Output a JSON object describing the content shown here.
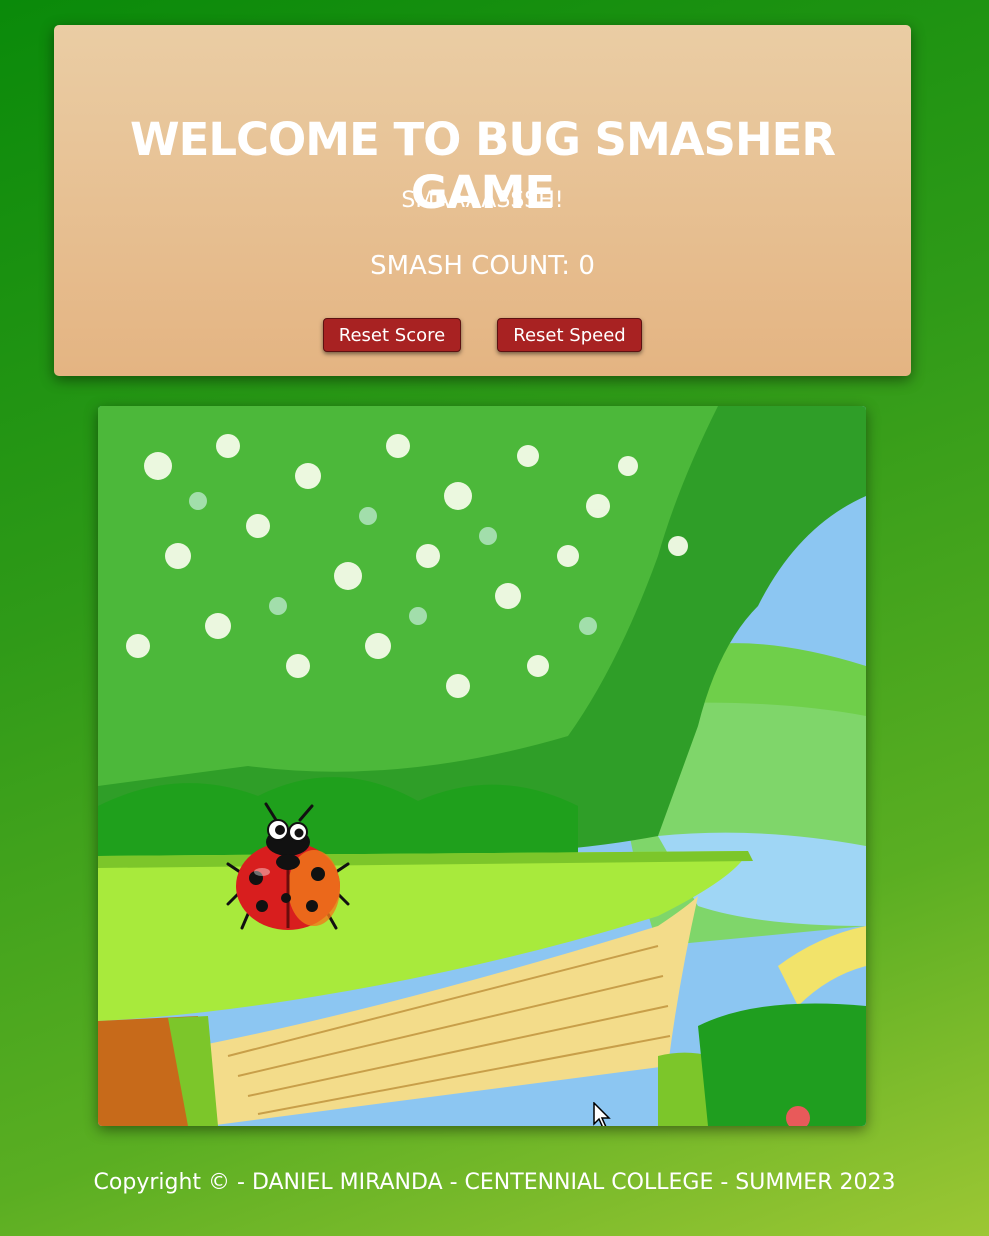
{
  "header": {
    "title": "WELCOME TO BUG SMASHER GAME",
    "subtitle": "SMAAAASSSH!",
    "count_label": "SMASH COUNT: 0",
    "reset_score_label": "Reset Score",
    "reset_speed_label": "Reset Speed"
  },
  "game": {
    "bug_icon": "ladybug-icon",
    "cursor_icon": "mouse-pointer-icon",
    "background": "forest-pond-book-scene"
  },
  "footer": {
    "text": "Copyright © - DANIEL MIRANDA - CENTENNIAL COLLEGE - SUMMER 2023"
  },
  "colors": {
    "page_bg": "#2f9a18",
    "header_bg": "#e4b482",
    "button_bg": "#a82222",
    "text": "#ffffff"
  }
}
